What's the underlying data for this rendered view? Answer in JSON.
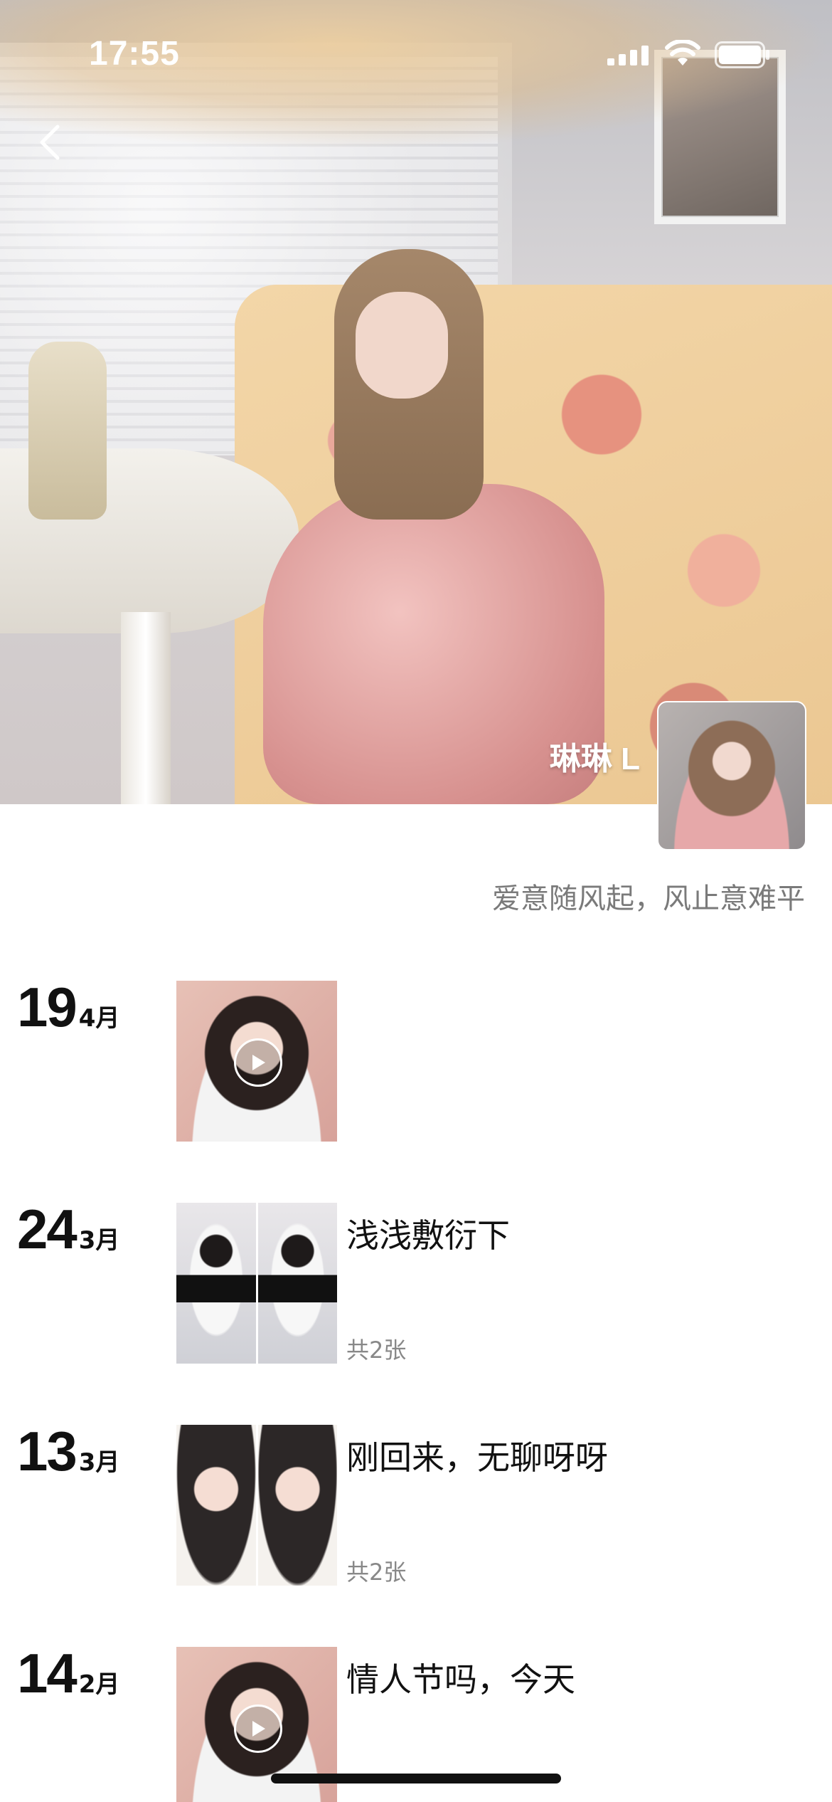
{
  "status_bar": {
    "time": "17:55"
  },
  "profile": {
    "name": "琳琳 L",
    "signature": "爱意随风起，风止意难平"
  },
  "icons": {
    "back": "chevron-left-icon",
    "signal": "cellular-signal-icon",
    "wifi": "wifi-icon",
    "battery": "battery-icon",
    "play": "play-icon"
  },
  "timeline": [
    {
      "day": "19",
      "month": "4月",
      "caption": "",
      "count": "",
      "type": "video"
    },
    {
      "day": "24",
      "month": "3月",
      "caption": "浅浅敷衍下",
      "count": "共2张",
      "type": "photos"
    },
    {
      "day": "13",
      "month": "3月",
      "caption": "刚回来，无聊呀呀",
      "count": "共2张",
      "type": "photos"
    },
    {
      "day": "14",
      "month": "2月",
      "caption": "情人节吗，今天",
      "count": "",
      "type": "video"
    }
  ]
}
